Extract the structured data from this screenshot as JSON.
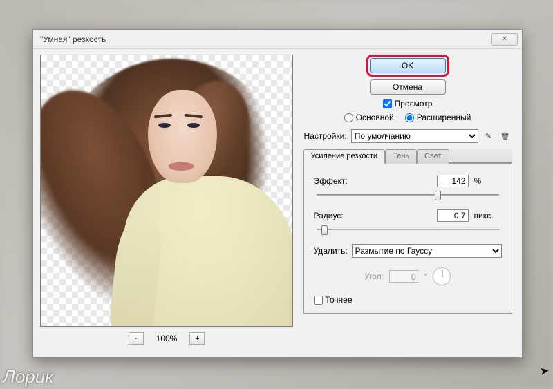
{
  "window": {
    "title": "\"Умная\" резкость"
  },
  "buttons": {
    "ok": "OK",
    "cancel": "Отмена"
  },
  "preview_checkbox": "Просмотр",
  "mode": {
    "basic": "Основной",
    "advanced": "Расширенный"
  },
  "settings": {
    "label": "Настройки:",
    "value": "По умолчанию"
  },
  "tabs": {
    "sharpen": "Усиление резкости",
    "shadow": "Тень",
    "highlight": "Свет"
  },
  "params": {
    "amount_label": "Эффект:",
    "amount_value": "142",
    "amount_unit": "%",
    "radius_label": "Радиус:",
    "radius_value": "0,7",
    "radius_unit": "пикс.",
    "remove_label": "Удалить:",
    "remove_value": "Размытие по Гауссу",
    "angle_label": "Угол:",
    "angle_value": "0",
    "angle_unit": "°",
    "accurate": "Точнее"
  },
  "zoom": {
    "minus": "-",
    "value": "100%",
    "plus": "+"
  },
  "watermark": "Лорик"
}
